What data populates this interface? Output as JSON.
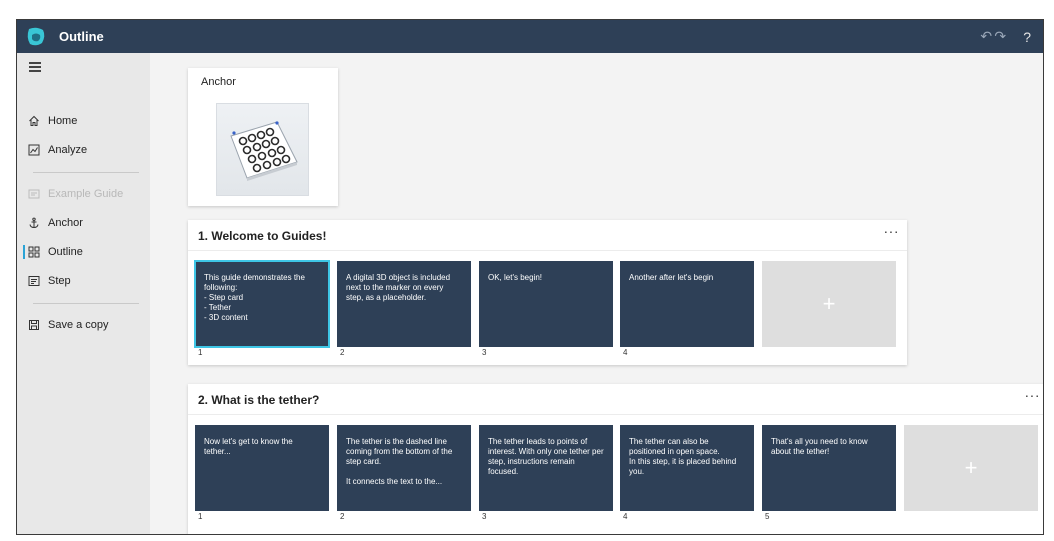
{
  "app": {
    "title": "Outline",
    "undo_icon": "undo-icon",
    "redo_icon": "redo-icon",
    "help": "?"
  },
  "sidebar": {
    "items": [
      {
        "label": "Home",
        "icon": "home-icon"
      },
      {
        "label": "Analyze",
        "icon": "analyze-icon"
      },
      {
        "label": "Example Guide",
        "icon": "guide-icon",
        "disabled": true
      },
      {
        "label": "Anchor",
        "icon": "anchor-icon"
      },
      {
        "label": "Outline",
        "icon": "outline-icon",
        "active": true
      },
      {
        "label": "Step",
        "icon": "step-icon"
      },
      {
        "label": "Save a copy",
        "icon": "save-icon"
      }
    ]
  },
  "anchor": {
    "title": "Anchor"
  },
  "sections": [
    {
      "title": "1. Welcome to Guides!",
      "more": "···",
      "add": "+",
      "steps": [
        {
          "text": "This guide demonstrates the following:\n- Step card\n- Tether\n- 3D content",
          "number": "1"
        },
        {
          "text": "A digital 3D object is included next to the marker on every step, as a placeholder.",
          "number": "2"
        },
        {
          "text": "OK, let's begin!",
          "number": "3"
        },
        {
          "text": "Another after let's begin",
          "number": "4"
        }
      ]
    },
    {
      "title": "2. What is the tether?",
      "more": "···",
      "add": "+",
      "steps": [
        {
          "text": "Now let's get to know the tether...",
          "number": "1"
        },
        {
          "text": "The tether is the dashed line coming from the bottom of the step card.\n\nIt connects the text to the...",
          "number": "2"
        },
        {
          "text": "The tether leads to points of interest.  With only one tether per step, instructions remain focused.",
          "number": "3"
        },
        {
          "text": "The tether can also be positioned in open space.\nIn this step, it is placed behind you.",
          "number": "4"
        },
        {
          "text": "That's all you need to know about the tether!",
          "number": "5"
        }
      ]
    }
  ],
  "colors": {
    "titlebar": "#2e4057",
    "card": "#2e4057",
    "accent": "#3ec6e6"
  }
}
